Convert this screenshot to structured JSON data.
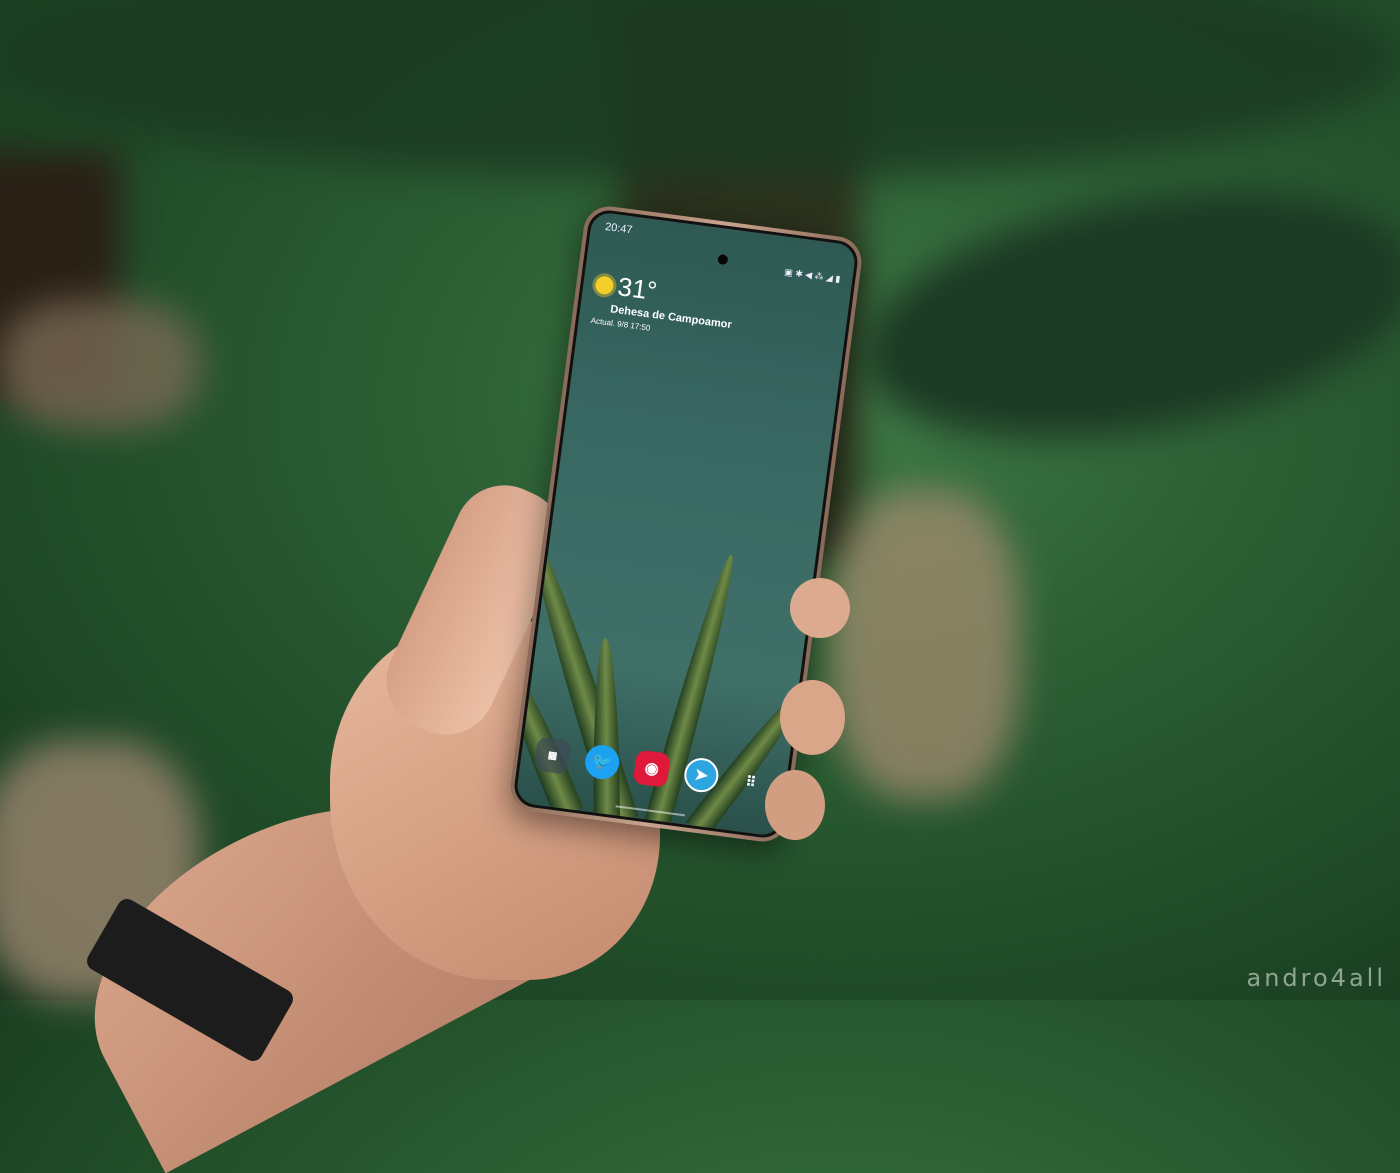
{
  "status_bar": {
    "time": "20:47"
  },
  "weather_widget": {
    "icon": "sun-icon",
    "temperature": "31°",
    "location": "Dehesa de Campoamor",
    "updated": "Actual. 9/8 17:50"
  },
  "dock": [
    {
      "icon": "folder-icon",
      "color": "#3c4a56"
    },
    {
      "icon": "twitter-icon",
      "color": "#1da1f2"
    },
    {
      "icon": "camera-icon",
      "color": "#e0183a"
    },
    {
      "icon": "telegram-icon",
      "color": "#2ca5e0"
    },
    {
      "icon": "apps-grid-icon",
      "color": "#3c4a56"
    }
  ],
  "watermark": "andro4all"
}
